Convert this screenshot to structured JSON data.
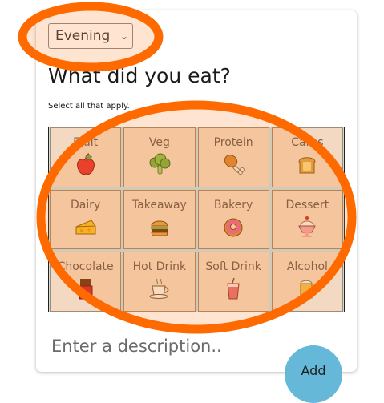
{
  "meal_select": {
    "value": "Evening",
    "icon": "chevron-down-icon"
  },
  "title": "What did you eat?",
  "subtitle": "Select all that apply.",
  "categories": [
    {
      "label": "Fruit",
      "icon": "apple-icon"
    },
    {
      "label": "Veg",
      "icon": "broccoli-icon"
    },
    {
      "label": "Protein",
      "icon": "drumstick-icon"
    },
    {
      "label": "Carbs",
      "icon": "bread-icon"
    },
    {
      "label": "Dairy",
      "icon": "cheese-icon"
    },
    {
      "label": "Takeaway",
      "icon": "burger-icon"
    },
    {
      "label": "Bakery",
      "icon": "donut-icon"
    },
    {
      "label": "Dessert",
      "icon": "sundae-icon"
    },
    {
      "label": "Chocolate",
      "icon": "chocolate-bar-icon"
    },
    {
      "label": "Hot Drink",
      "icon": "hot-drink-icon"
    },
    {
      "label": "Soft Drink",
      "icon": "soft-drink-icon"
    },
    {
      "label": "Alcohol",
      "icon": "beer-mug-icon"
    }
  ],
  "description": {
    "placeholder": "Enter a description.."
  },
  "add_button": {
    "label": "Add"
  },
  "colors": {
    "highlight": "#ff6a00",
    "add_button": "#66b8d9",
    "tile": "#f3d9c1",
    "grid_background": "#c8dede"
  }
}
